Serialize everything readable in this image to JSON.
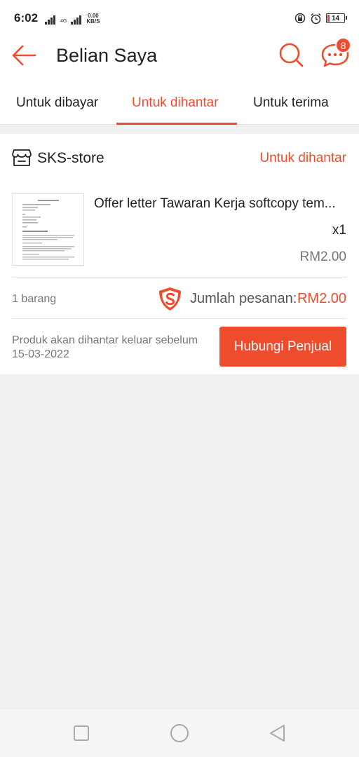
{
  "status_bar": {
    "time": "6:02",
    "network_label": "4G",
    "speed_value": "0.00",
    "speed_unit": "KB/S",
    "battery_level": "14"
  },
  "header": {
    "title": "Belian Saya",
    "chat_badge_count": "8"
  },
  "tabs": [
    {
      "label": "Untuk dibayar",
      "active": false
    },
    {
      "label": "Untuk dihantar",
      "active": true
    },
    {
      "label": "Untuk terima",
      "active": false
    }
  ],
  "order": {
    "shop_name": "SKS-store",
    "status": "Untuk dihantar",
    "product": {
      "name": "Offer letter Tawaran Kerja softcopy tem...",
      "quantity": "x1",
      "price": "RM2.00"
    },
    "item_count": "1 barang",
    "total_label": "Jumlah pesanan:",
    "total_value": "RM2.00",
    "delivery_note_line1": "Produk akan dihantar keluar sebelum",
    "delivery_note_line2": "15-03-2022",
    "contact_button_label": "Hubungi Penjual"
  },
  "colors": {
    "accent": "#ee4d2d",
    "background": "#f0f0f0"
  }
}
